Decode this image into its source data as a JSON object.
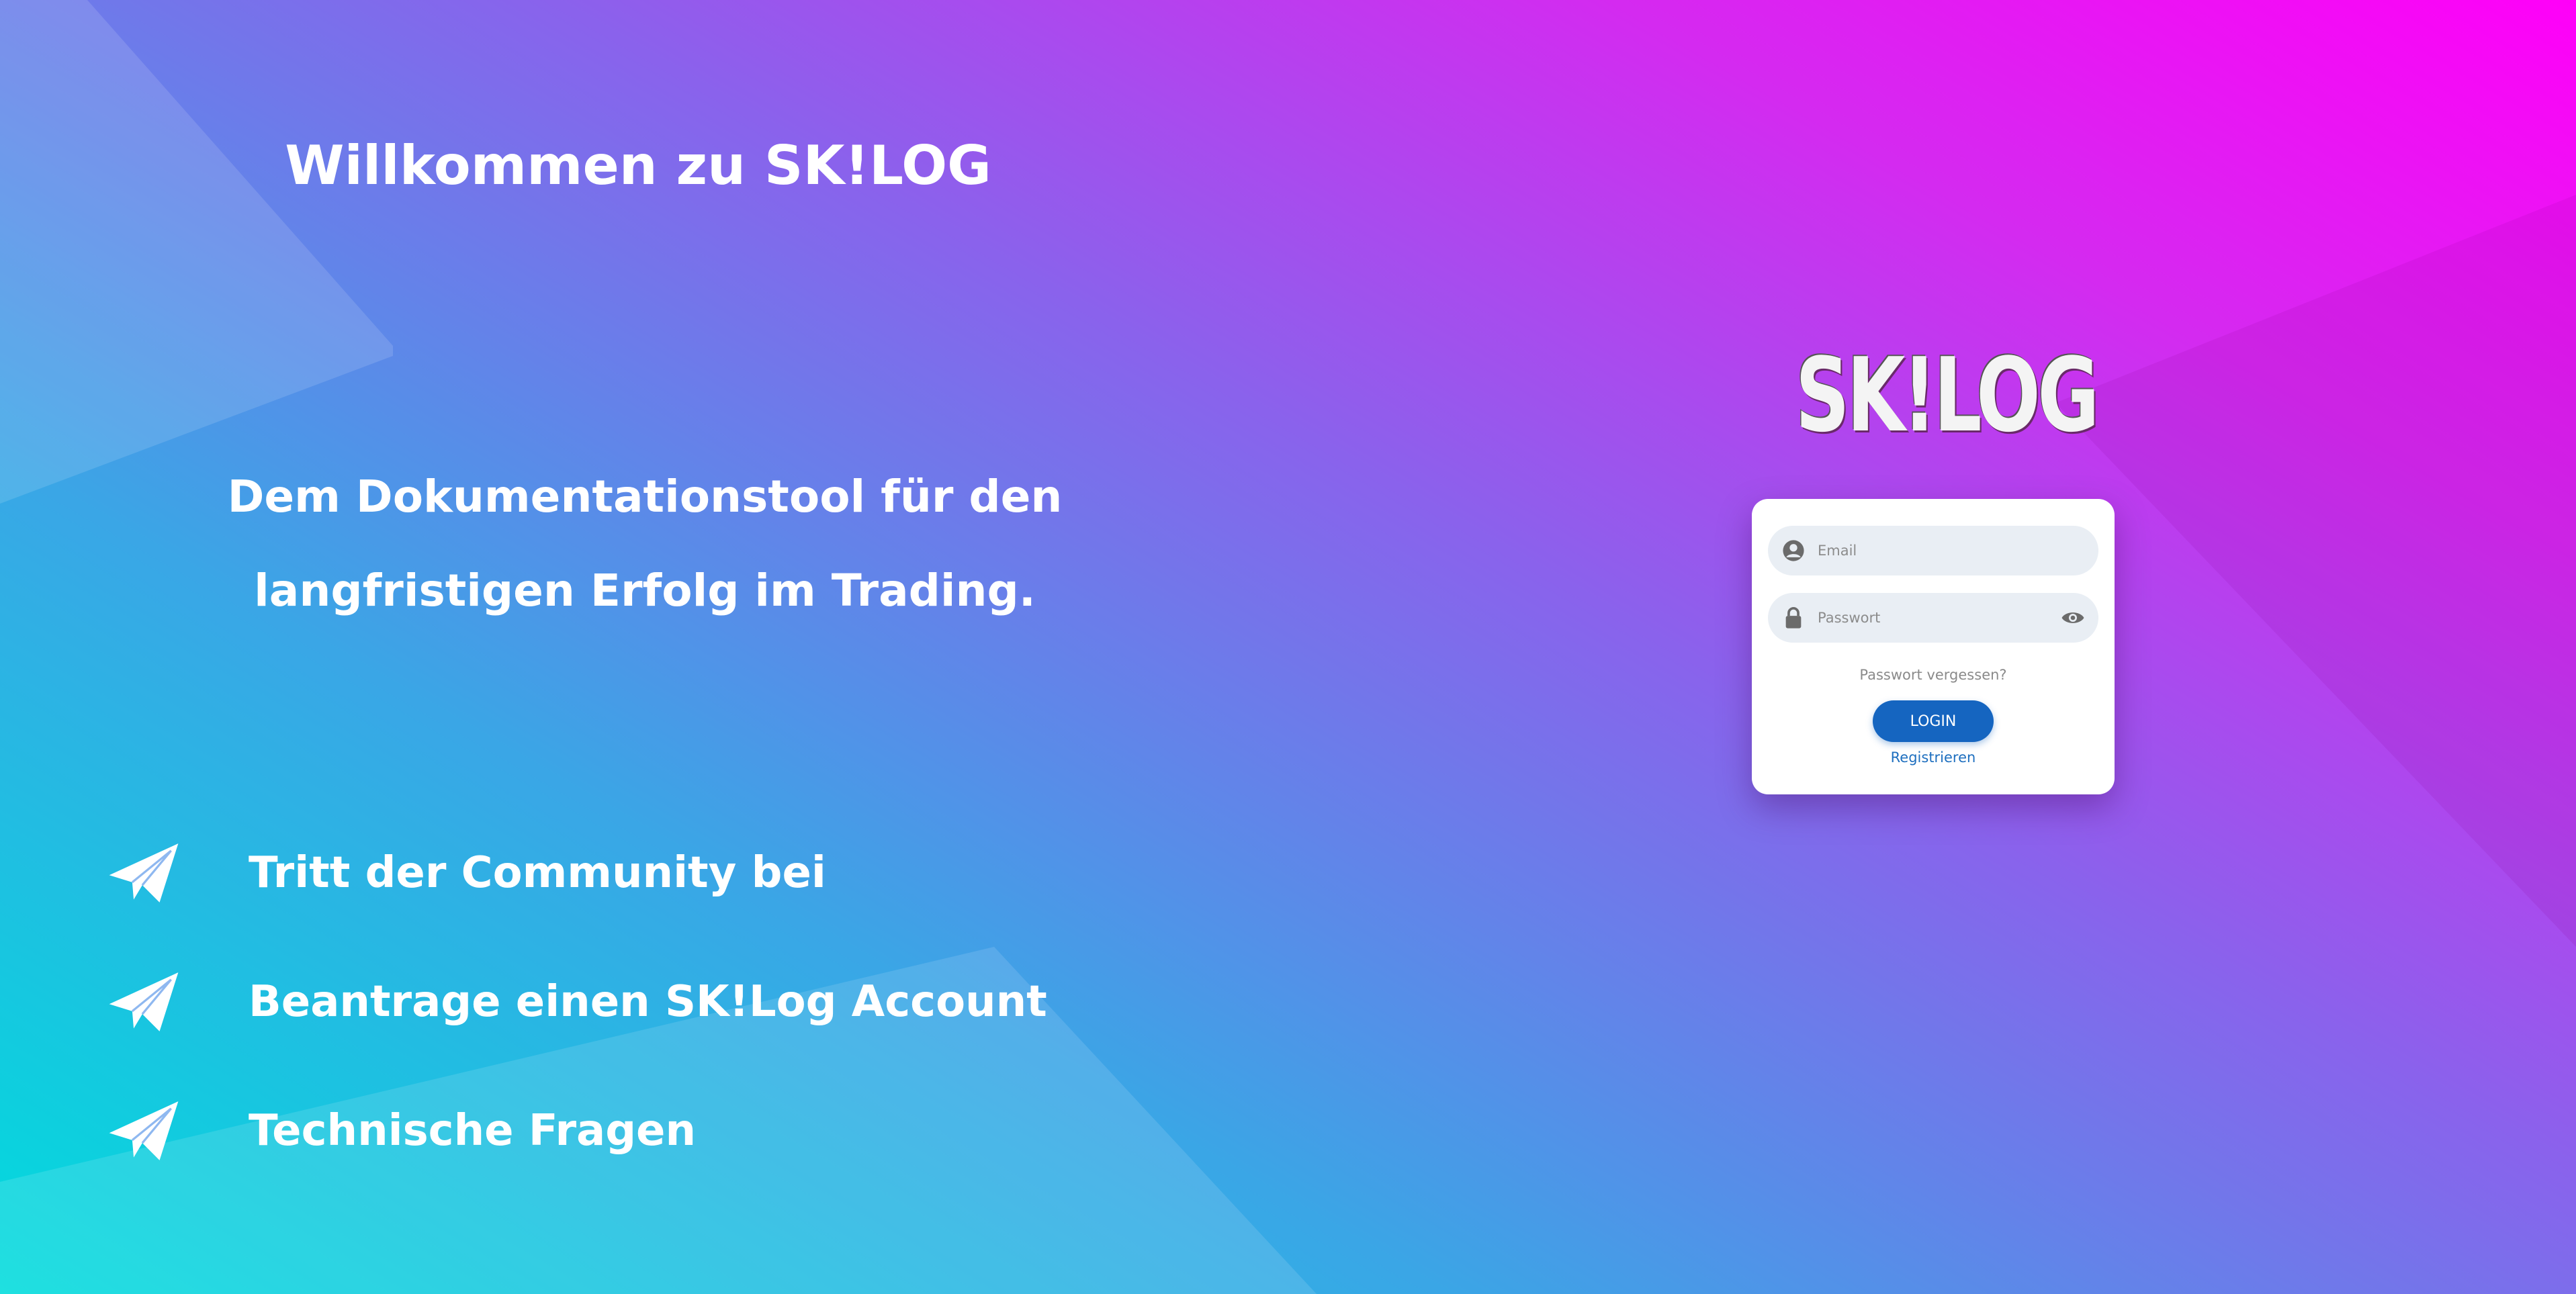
{
  "heading": {
    "title": "Willkommen zu SK!LOG"
  },
  "tagline": {
    "line1": "Dem Dokumentationstool für den",
    "line2": "langfristigen Erfolg im Trading."
  },
  "links": [
    {
      "icon": "telegram-icon",
      "label": "Tritt der Community bei"
    },
    {
      "icon": "telegram-icon",
      "label": "Beantrage einen SK!Log Account"
    },
    {
      "icon": "telegram-icon",
      "label": "Technische Fragen"
    }
  ],
  "logo": {
    "text": "SK!LOG"
  },
  "login": {
    "email_placeholder": "Email",
    "email_value": "",
    "password_placeholder": "Passwort",
    "password_value": "",
    "forgot_label": "Passwort vergessen?",
    "login_label": "LOGIN",
    "register_label": "Registrieren"
  },
  "colors": {
    "gradient_start": "#00dcdc",
    "gradient_end": "#ff00f8",
    "button": "#1565c0",
    "link": "#1e6fbf"
  }
}
